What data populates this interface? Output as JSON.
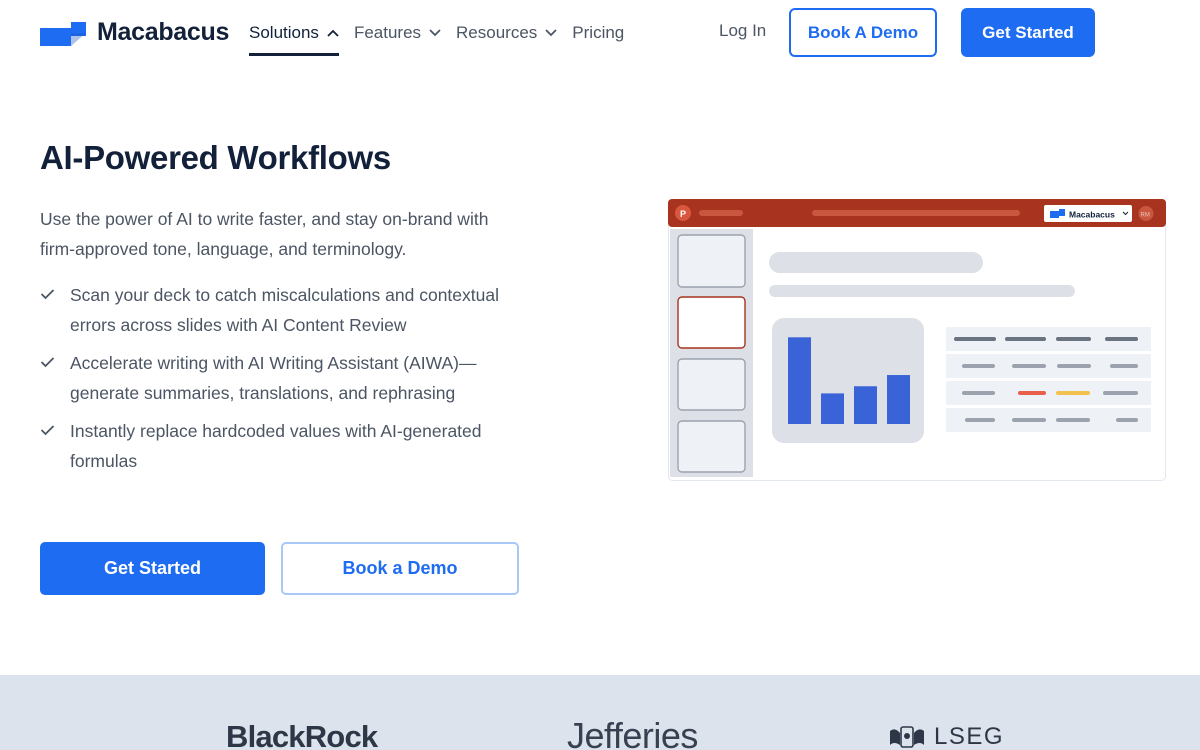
{
  "brand": {
    "name": "Macabacus",
    "accent": "#1e6cf2",
    "dark": "#12203a"
  },
  "nav": {
    "items": [
      {
        "label": "Solutions",
        "icon": "chevron-up-icon",
        "active": true
      },
      {
        "label": "Features",
        "icon": "chevron-down-icon",
        "active": false
      },
      {
        "label": "Resources",
        "icon": "chevron-down-icon",
        "active": false
      },
      {
        "label": "Pricing",
        "icon": "",
        "active": false
      }
    ],
    "login": "Log In",
    "book_demo": "Book A Demo",
    "get_started": "Get Started"
  },
  "hero": {
    "title": "AI-Powered Workflows",
    "description": "Use the power of AI to write faster, and stay on-brand with firm-approved tone, language, and terminology.",
    "features": [
      "Scan your deck to catch miscalculations and contextual errors across slides with AI Content Review",
      "Accelerate writing with AI Writing Assistant (AIWA)—generate summaries, translations, and rephrasing",
      "Instantly replace hardcoded values with AI-generated formulas"
    ],
    "primary_button": "Get Started",
    "secondary_button": "Book a Demo"
  },
  "illustration": {
    "ribbon_color": "#a8341f",
    "addin_label": "Macabacus",
    "avatar_initials": "RM",
    "bar_values": [
      0.85,
      0.3,
      0.37,
      0.48
    ],
    "status_colors": [
      "#e8604c",
      "#f2c14e"
    ]
  },
  "clients": {
    "logos": [
      "BlackRock",
      "Jefferies",
      "LSEG"
    ]
  }
}
